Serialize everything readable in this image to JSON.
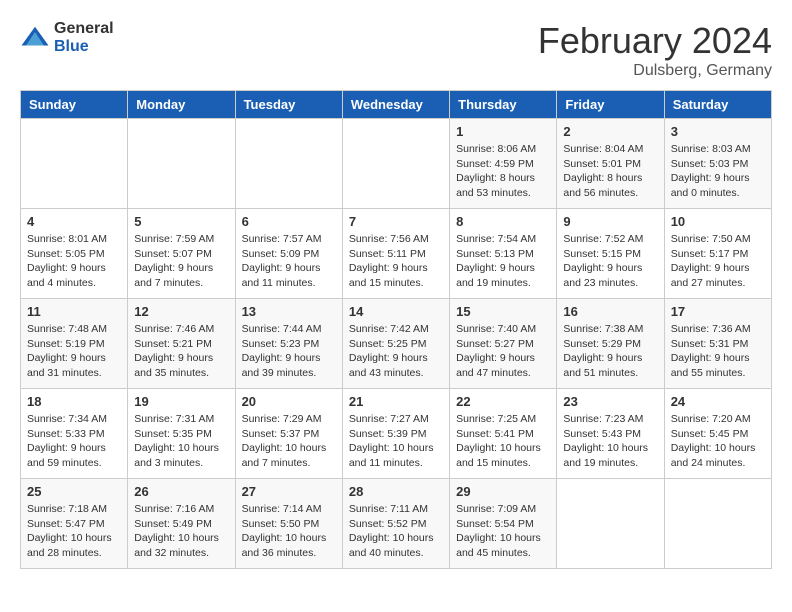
{
  "logo": {
    "general": "General",
    "blue": "Blue"
  },
  "title": "February 2024",
  "subtitle": "Dulsberg, Germany",
  "days_of_week": [
    "Sunday",
    "Monday",
    "Tuesday",
    "Wednesday",
    "Thursday",
    "Friday",
    "Saturday"
  ],
  "weeks": [
    [
      {
        "day": "",
        "info": ""
      },
      {
        "day": "",
        "info": ""
      },
      {
        "day": "",
        "info": ""
      },
      {
        "day": "",
        "info": ""
      },
      {
        "day": "1",
        "info": "Sunrise: 8:06 AM\nSunset: 4:59 PM\nDaylight: 8 hours\nand 53 minutes."
      },
      {
        "day": "2",
        "info": "Sunrise: 8:04 AM\nSunset: 5:01 PM\nDaylight: 8 hours\nand 56 minutes."
      },
      {
        "day": "3",
        "info": "Sunrise: 8:03 AM\nSunset: 5:03 PM\nDaylight: 9 hours\nand 0 minutes."
      }
    ],
    [
      {
        "day": "4",
        "info": "Sunrise: 8:01 AM\nSunset: 5:05 PM\nDaylight: 9 hours\nand 4 minutes."
      },
      {
        "day": "5",
        "info": "Sunrise: 7:59 AM\nSunset: 5:07 PM\nDaylight: 9 hours\nand 7 minutes."
      },
      {
        "day": "6",
        "info": "Sunrise: 7:57 AM\nSunset: 5:09 PM\nDaylight: 9 hours\nand 11 minutes."
      },
      {
        "day": "7",
        "info": "Sunrise: 7:56 AM\nSunset: 5:11 PM\nDaylight: 9 hours\nand 15 minutes."
      },
      {
        "day": "8",
        "info": "Sunrise: 7:54 AM\nSunset: 5:13 PM\nDaylight: 9 hours\nand 19 minutes."
      },
      {
        "day": "9",
        "info": "Sunrise: 7:52 AM\nSunset: 5:15 PM\nDaylight: 9 hours\nand 23 minutes."
      },
      {
        "day": "10",
        "info": "Sunrise: 7:50 AM\nSunset: 5:17 PM\nDaylight: 9 hours\nand 27 minutes."
      }
    ],
    [
      {
        "day": "11",
        "info": "Sunrise: 7:48 AM\nSunset: 5:19 PM\nDaylight: 9 hours\nand 31 minutes."
      },
      {
        "day": "12",
        "info": "Sunrise: 7:46 AM\nSunset: 5:21 PM\nDaylight: 9 hours\nand 35 minutes."
      },
      {
        "day": "13",
        "info": "Sunrise: 7:44 AM\nSunset: 5:23 PM\nDaylight: 9 hours\nand 39 minutes."
      },
      {
        "day": "14",
        "info": "Sunrise: 7:42 AM\nSunset: 5:25 PM\nDaylight: 9 hours\nand 43 minutes."
      },
      {
        "day": "15",
        "info": "Sunrise: 7:40 AM\nSunset: 5:27 PM\nDaylight: 9 hours\nand 47 minutes."
      },
      {
        "day": "16",
        "info": "Sunrise: 7:38 AM\nSunset: 5:29 PM\nDaylight: 9 hours\nand 51 minutes."
      },
      {
        "day": "17",
        "info": "Sunrise: 7:36 AM\nSunset: 5:31 PM\nDaylight: 9 hours\nand 55 minutes."
      }
    ],
    [
      {
        "day": "18",
        "info": "Sunrise: 7:34 AM\nSunset: 5:33 PM\nDaylight: 9 hours\nand 59 minutes."
      },
      {
        "day": "19",
        "info": "Sunrise: 7:31 AM\nSunset: 5:35 PM\nDaylight: 10 hours\nand 3 minutes."
      },
      {
        "day": "20",
        "info": "Sunrise: 7:29 AM\nSunset: 5:37 PM\nDaylight: 10 hours\nand 7 minutes."
      },
      {
        "day": "21",
        "info": "Sunrise: 7:27 AM\nSunset: 5:39 PM\nDaylight: 10 hours\nand 11 minutes."
      },
      {
        "day": "22",
        "info": "Sunrise: 7:25 AM\nSunset: 5:41 PM\nDaylight: 10 hours\nand 15 minutes."
      },
      {
        "day": "23",
        "info": "Sunrise: 7:23 AM\nSunset: 5:43 PM\nDaylight: 10 hours\nand 19 minutes."
      },
      {
        "day": "24",
        "info": "Sunrise: 7:20 AM\nSunset: 5:45 PM\nDaylight: 10 hours\nand 24 minutes."
      }
    ],
    [
      {
        "day": "25",
        "info": "Sunrise: 7:18 AM\nSunset: 5:47 PM\nDaylight: 10 hours\nand 28 minutes."
      },
      {
        "day": "26",
        "info": "Sunrise: 7:16 AM\nSunset: 5:49 PM\nDaylight: 10 hours\nand 32 minutes."
      },
      {
        "day": "27",
        "info": "Sunrise: 7:14 AM\nSunset: 5:50 PM\nDaylight: 10 hours\nand 36 minutes."
      },
      {
        "day": "28",
        "info": "Sunrise: 7:11 AM\nSunset: 5:52 PM\nDaylight: 10 hours\nand 40 minutes."
      },
      {
        "day": "29",
        "info": "Sunrise: 7:09 AM\nSunset: 5:54 PM\nDaylight: 10 hours\nand 45 minutes."
      },
      {
        "day": "",
        "info": ""
      },
      {
        "day": "",
        "info": ""
      }
    ]
  ]
}
